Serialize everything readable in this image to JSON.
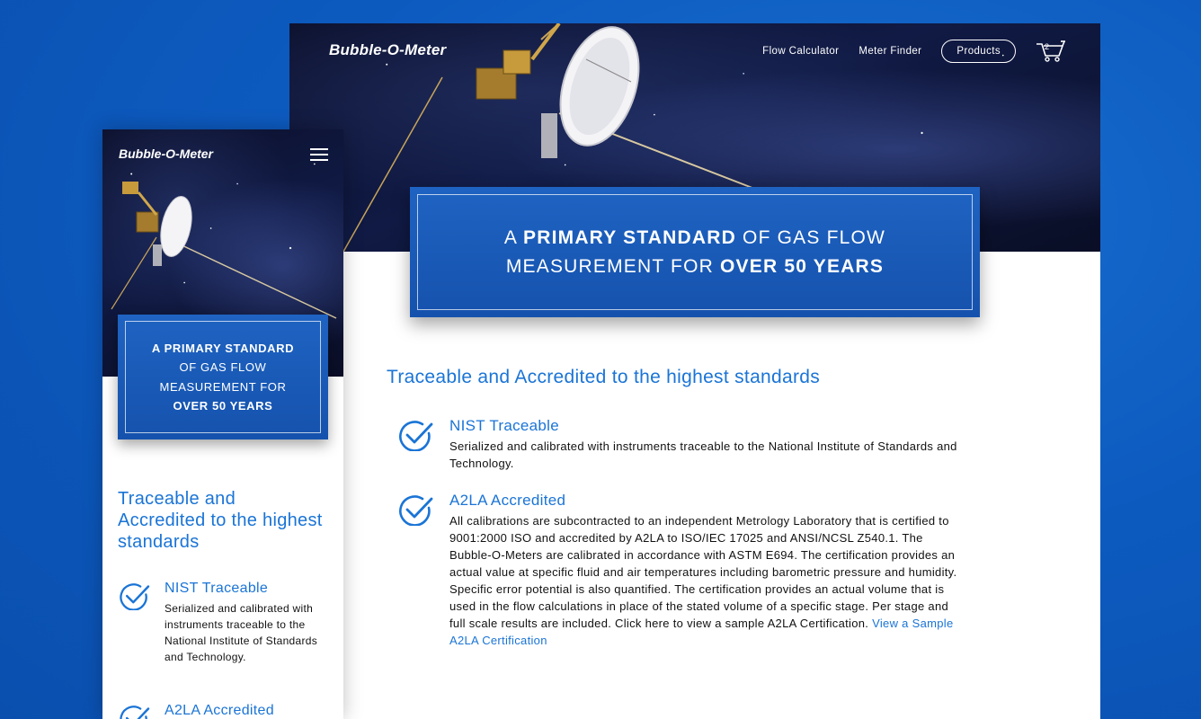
{
  "desktop": {
    "logo": "Bubble-O-Meter",
    "nav": {
      "flow_calculator": "Flow Calculator",
      "meter_finder": "Meter Finder",
      "products": "Products",
      "cart_count": "2"
    },
    "banner": {
      "line1_pre": "A ",
      "line1_bold": "PRIMARY STANDARD",
      "line1_post": " OF GAS FLOW",
      "line2_pre": "MEASUREMENT FOR ",
      "line2_bold": "OVER 50 YEARS"
    },
    "section_title": "Traceable and Accredited to the highest standards",
    "features": [
      {
        "title": "NIST Traceable",
        "body": "Serialized and calibrated with instruments traceable to the National Institute of Standards and Technology."
      },
      {
        "title": "A2LA Accredited",
        "body": "All calibrations are subcontracted to an independent Metrology Laboratory that is certified to 9001:2000 ISO and accredited by A2LA to ISO/IEC 17025 and ANSI/NCSL Z540.1.  The Bubble-O-Meters are calibrated in accordance with ASTM E694. The certification provides an actual value at specific fluid and air temperatures including barometric pressure and humidity. Specific error potential is also quantified. The certification provides an actual volume that is used in the flow calculations in place of the stated volume of a specific stage. Per stage and full scale results are included. Click here to view a sample A2LA Certification. ",
        "link": "View a Sample A2LA Certification"
      }
    ]
  },
  "mobile": {
    "logo": "Bubble-O-Meter",
    "banner": {
      "line1": "A PRIMARY STANDARD",
      "line2": "OF GAS FLOW",
      "line3": "MEASUREMENT FOR",
      "line4": "OVER 50 YEARS"
    },
    "section_title": "Traceable and Accredited to the highest standards",
    "features": [
      {
        "title": "NIST Traceable",
        "body": "Serialized and calibrated with instruments traceable to the National Institute of Standards and Technology."
      },
      {
        "title": "A2LA Accredited"
      }
    ]
  },
  "colors": {
    "background": "#0d5bc0",
    "accent": "#1a74d6",
    "banner": "#1552ad"
  },
  "icons": [
    "cart-icon",
    "hamburger-menu-icon",
    "check-circle-icon"
  ]
}
